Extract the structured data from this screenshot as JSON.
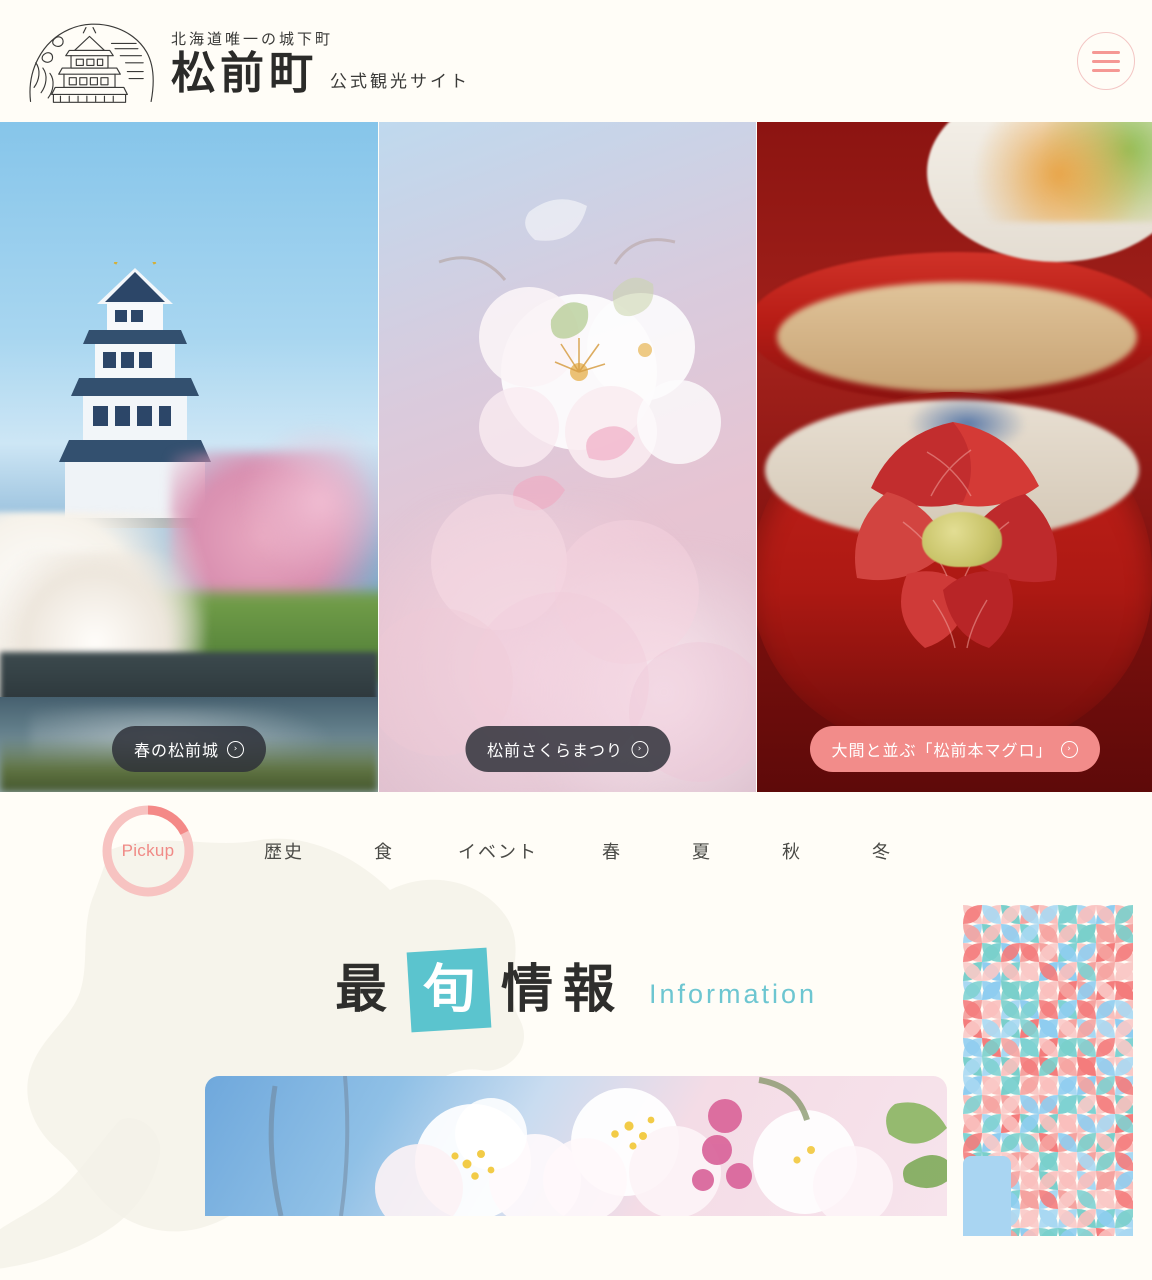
{
  "header": {
    "logo_icon": "castle-wave-logo",
    "tagline": "北海道唯一の城下町",
    "site_name": "松前町",
    "site_subtitle": "公式観光サイト",
    "menu_icon": "hamburger-menu-icon"
  },
  "hero": {
    "slides": [
      {
        "id": "spring-castle",
        "caption": "春の松前城",
        "arrow": "›",
        "style": "dark",
        "alt": "春の松前城と桜"
      },
      {
        "id": "sakura-festival",
        "caption": "松前さくらまつり",
        "arrow": "›",
        "style": "dark",
        "alt": "松前さくらまつりの桜"
      },
      {
        "id": "honmaguro",
        "caption": "大間と並ぶ「松前本マグロ」",
        "arrow": "›",
        "style": "accent",
        "alt": "松前本マグロの海鮮丼"
      }
    ]
  },
  "categories": {
    "pickup_label": "Pickup",
    "items": [
      {
        "label": "歴史"
      },
      {
        "label": "食"
      },
      {
        "label": "イベント"
      },
      {
        "label": "春"
      },
      {
        "label": "夏"
      },
      {
        "label": "秋"
      },
      {
        "label": "冬"
      }
    ]
  },
  "information": {
    "title_part1": "最",
    "title_badge": "旬",
    "title_part2": "情報",
    "title_en": "Information",
    "card_alt": "桜の花のクローズアップ"
  },
  "colors": {
    "background": "#FFFDF7",
    "accent_pink": "#F28C8A",
    "accent_pink_light": "#F7C3C1",
    "teal": "#5BC4CE",
    "teal_text": "#6DC6D1",
    "blue_card": "#A9D5F2",
    "text_dark": "#2e2e2c"
  },
  "decor": {
    "map_watermark": "hokkaido-map-watermark",
    "pattern": "petal-grid-pattern"
  }
}
